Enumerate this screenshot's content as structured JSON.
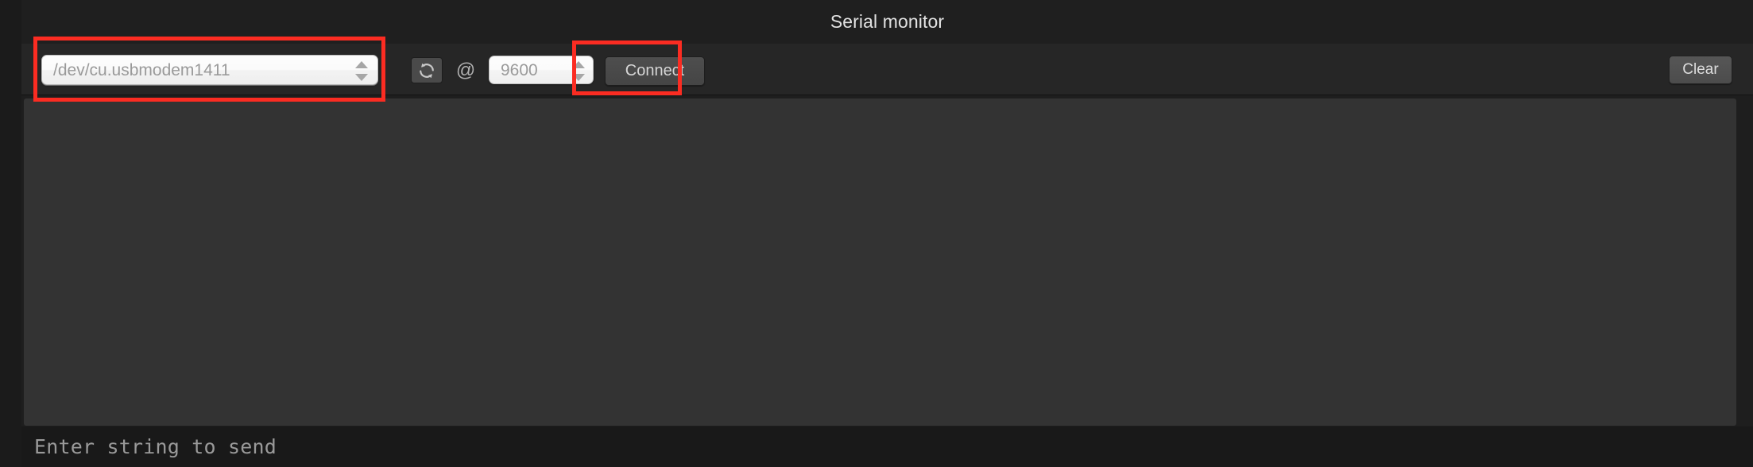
{
  "window": {
    "title": "Serial monitor"
  },
  "toolbar": {
    "port_select": {
      "icon": "stepper-updown-icon",
      "value": "/dev/cu.usbmodem1411",
      "placeholder": "/dev/cu.usbmodem1411"
    },
    "refresh_button": {
      "icon": "refresh-icon",
      "label": ""
    },
    "at_separator": "@",
    "baud_field": {
      "icon": "stepper-updown-icon",
      "value": "9600",
      "placeholder": "9600"
    },
    "connect_button": {
      "label": "Connect"
    },
    "clear_button": {
      "label": "Clear"
    }
  },
  "log": {
    "content": ""
  },
  "send_bar": {
    "value": "",
    "placeholder": "Enter string to send"
  },
  "annotations": {
    "highlight_color": "#fb2c22",
    "boxes": [
      {
        "name": "port-select-highlight",
        "target": "port_select"
      },
      {
        "name": "connect-button-highlight",
        "target": "connect_button"
      }
    ]
  },
  "colors": {
    "window_background": "#1e1e1e",
    "titlebar_background": "#1f1f1f",
    "toolbar_background": "#262626",
    "log_background": "#333333",
    "send_bar_background": "#191919",
    "title_text": "#e2e2e2",
    "muted_text": "#9a9a9a",
    "button_text": "#d6d6d6",
    "highlight": "#fb2c22"
  }
}
